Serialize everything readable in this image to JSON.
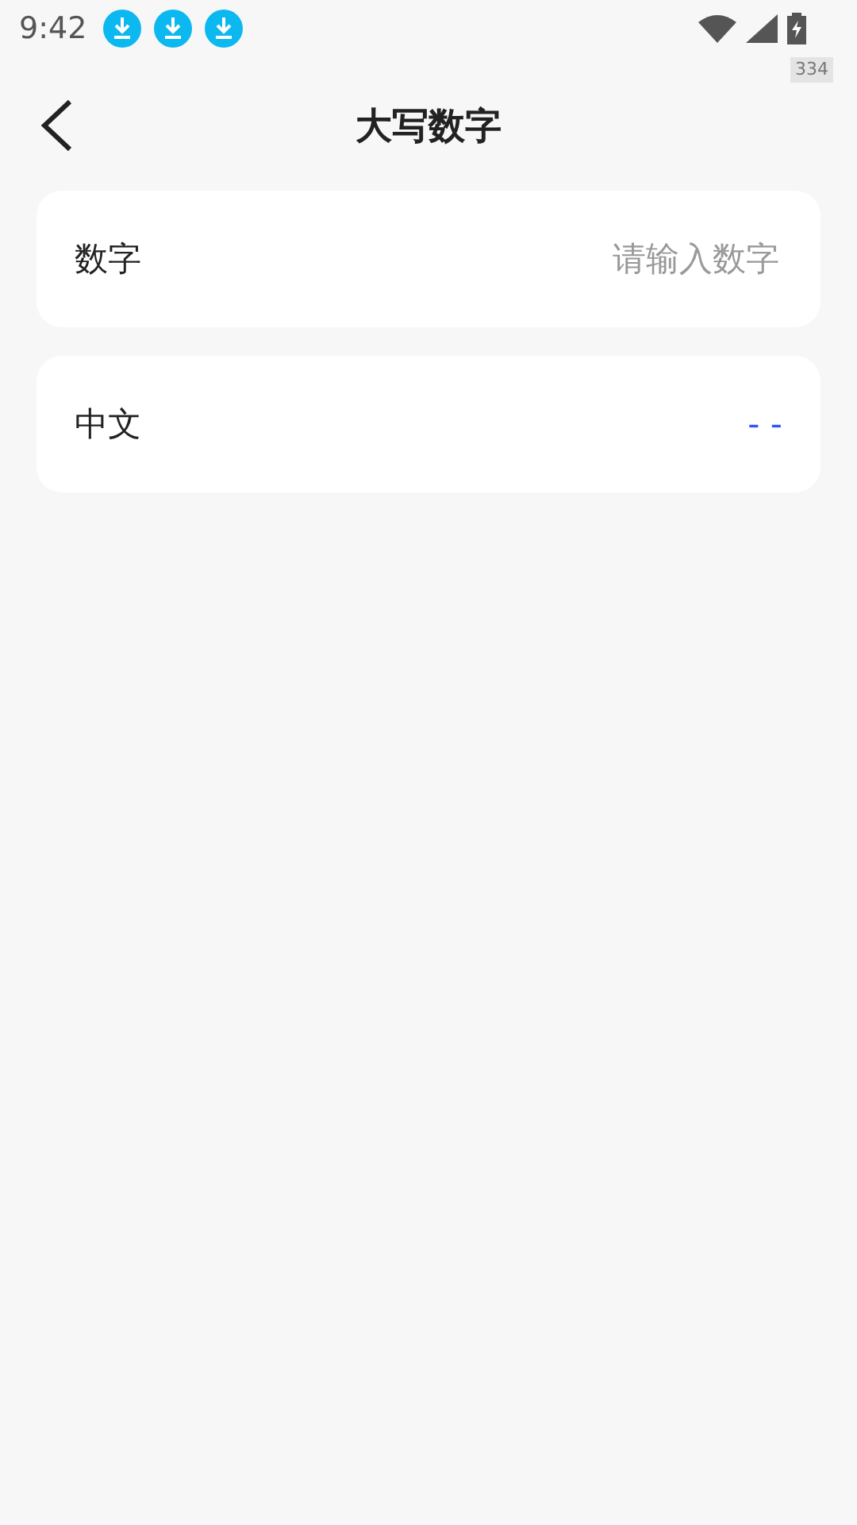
{
  "status_bar": {
    "time": "9:42",
    "notifications": [
      {
        "kind": "download"
      },
      {
        "kind": "download"
      },
      {
        "kind": "download"
      }
    ],
    "badge": "334"
  },
  "header": {
    "title": "大写数字"
  },
  "input_row": {
    "label": "数字",
    "placeholder": "请输入数字"
  },
  "result_row": {
    "label": "中文",
    "value": "- -"
  }
}
